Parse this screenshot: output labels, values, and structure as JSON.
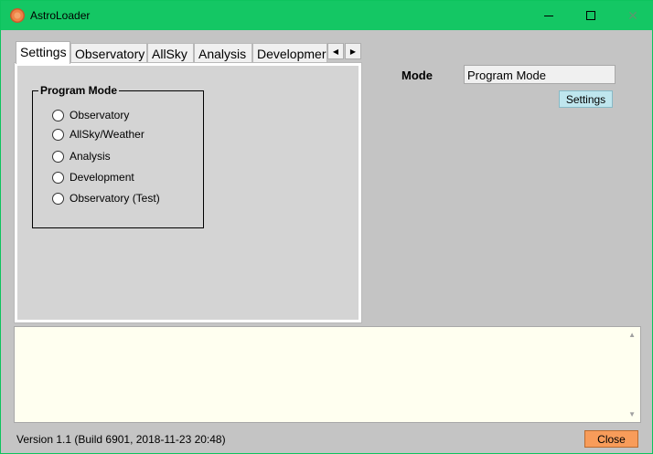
{
  "window": {
    "title": "AstroLoader"
  },
  "tabs": [
    "Settings",
    "Observatory",
    "AllSky",
    "Analysis",
    "Developmer"
  ],
  "program_mode": {
    "label": "Program Mode",
    "options": [
      "Observatory",
      "AllSky/Weather",
      "Analysis",
      "Development",
      "Observatory (Test)"
    ]
  },
  "mode": {
    "label": "Mode",
    "value": "Program Mode"
  },
  "settings_button": "Settings",
  "footer": {
    "version": "Version  1.1  (Build 6901, 2018-11-23 20:48)",
    "close_label": "Close"
  },
  "colors": {
    "titlebar": "#14c764",
    "log_background": "#fffff0",
    "settings_button": "#bfe6ee",
    "close_button": "#f89c5a"
  }
}
